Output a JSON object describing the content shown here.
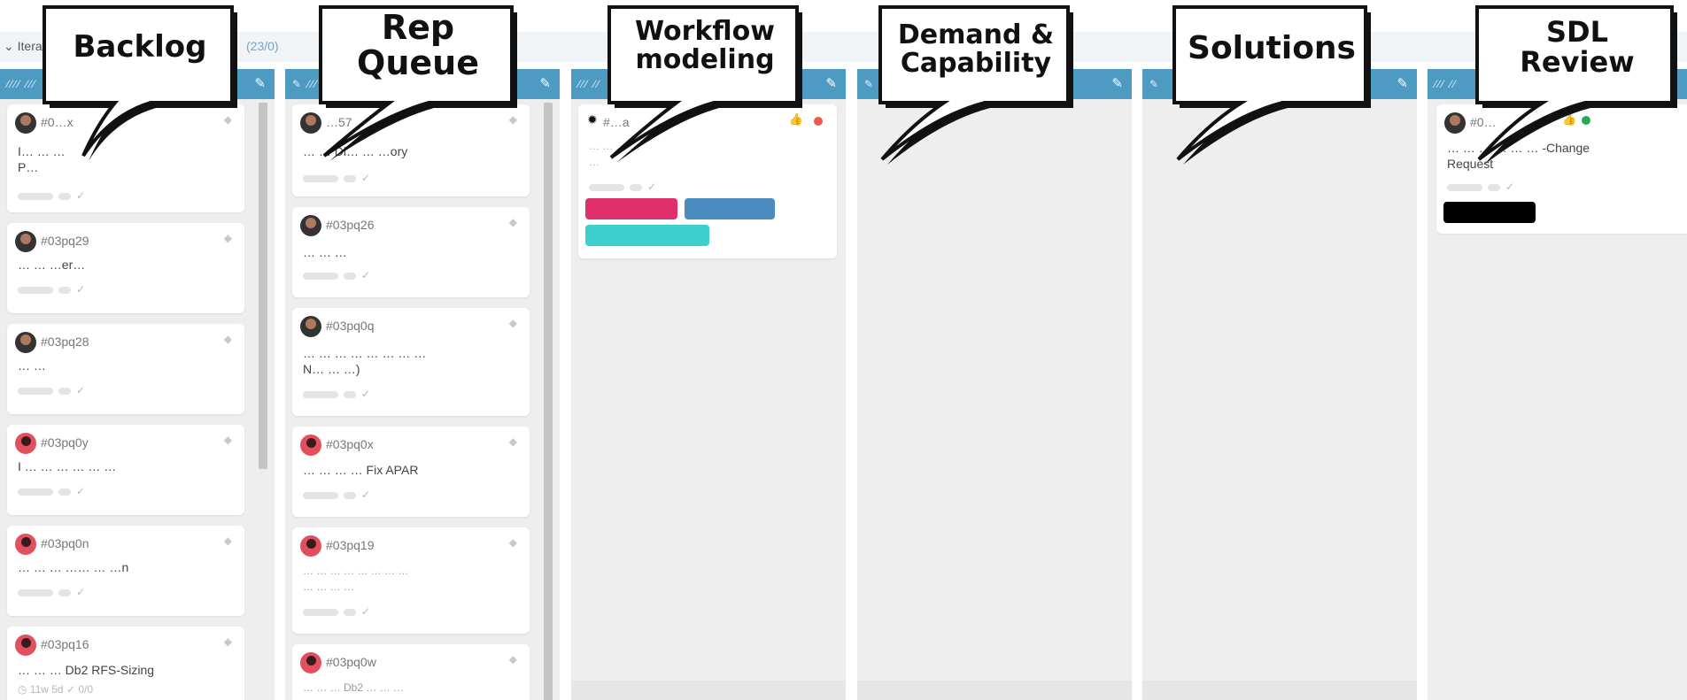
{
  "iteration": {
    "label": "Itera",
    "count": "(23/0)"
  },
  "columns": [
    {
      "callout": [
        "Backlog"
      ],
      "header_icons": "✎ ✎",
      "cards": [
        {
          "id": "#0…x",
          "title": "I… … …\nP…"
        },
        {
          "id": "#03pq29",
          "title": "… … …er…"
        },
        {
          "id": "#03pq28",
          "title": "… …"
        },
        {
          "id": "#03pq0y",
          "title": "I … … … … … …"
        },
        {
          "id": "#03pq0n",
          "title": "… … … …… … …n"
        },
        {
          "id": "#03pq16",
          "title": "… … … Db2 RFS-Sizing",
          "meta": "◷ 11w 5d  ✓ 0/0"
        }
      ]
    },
    {
      "callout": [
        "Rep",
        "Queue"
      ],
      "header_icons": "✎ ✎",
      "cards": [
        {
          "id": "…57",
          "title": "… … Di… … …ory"
        },
        {
          "id": "#03pq26",
          "title": "… … …"
        },
        {
          "id": "#03pq0q",
          "title": "… … … … … … … …\nN… … …)"
        },
        {
          "id": "#03pq0x",
          "title": "… … … … Fix APAR"
        },
        {
          "id": "#03pq19",
          "title": "… … … … … … … …\n… … … …"
        },
        {
          "id": "#03pq0w",
          "title": "… … … Db2 … … …"
        }
      ]
    },
    {
      "callout": [
        "Workflow",
        "modeling"
      ],
      "header_icons": "✎ ✎",
      "cards": [
        {
          "id": "#…a",
          "title": "… … … …\n…"
        }
      ],
      "chips": [
        "#e0306c",
        "#4a8cc0",
        "#3ccfcf"
      ]
    },
    {
      "callout": [
        "Demand &",
        "Capability"
      ],
      "header_icons": "✎ ✎",
      "cards": []
    },
    {
      "callout": [
        "Solutions"
      ],
      "header_icons": "✎ ✎",
      "cards": []
    },
    {
      "callout": [
        "SDL",
        "Review"
      ],
      "header_icons": "✎ ✎",
      "cards": [
        {
          "id": "#0…",
          "title": "… … … … … … -Change\nRequest"
        }
      ],
      "chips": [
        "#000000"
      ]
    }
  ]
}
